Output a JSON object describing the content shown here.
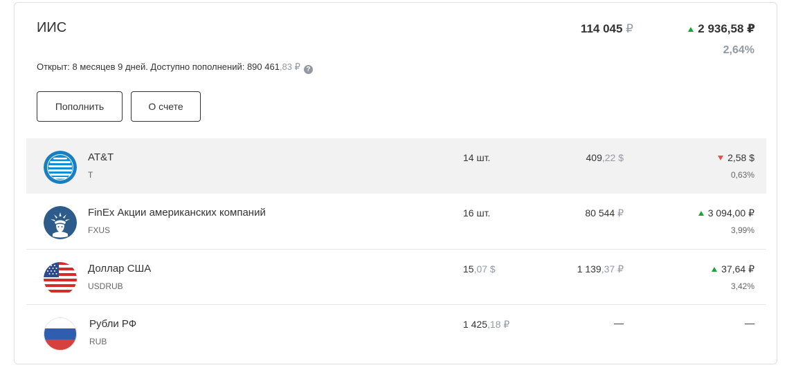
{
  "account": {
    "title": "ИИС",
    "total_int": "114 045",
    "total_currency": "₽",
    "gain": "2 936,58 ₽",
    "gain_pct": "2,64%",
    "info_prefix": "Открыт: 8 месяцев 9 дней. Доступно пополнений: 890 461",
    "info_frac": ",83 ₽",
    "help_glyph": "?"
  },
  "buttons": {
    "topup": "Пополнить",
    "about": "О счете"
  },
  "holdings": [
    {
      "name": "AT&T",
      "ticker": "T",
      "qty": "14 шт.",
      "price_int": "409",
      "price_frac": ",22 $",
      "change": "2,58 $",
      "change_dir": "down",
      "change_pct": "0,63%",
      "logo": "att-logo-icon"
    },
    {
      "name": "FinEx Акции американских компаний",
      "ticker": "FXUS",
      "qty": "16 шт.",
      "price_int": "80 544",
      "price_frac": " ₽",
      "change": "3 094,00 ₽",
      "change_dir": "up",
      "change_pct": "3,99%",
      "logo": "finex-statue-of-liberty-icon"
    },
    {
      "name": "Доллар США",
      "ticker": "USDRUB",
      "qty_int": "15",
      "qty_frac": ",07 $",
      "price_int": "1 139",
      "price_frac": ",37 ₽",
      "change": "37,64 ₽",
      "change_dir": "up",
      "change_pct": "3,42%",
      "logo": "us-flag-icon"
    },
    {
      "name": "Рубли РФ",
      "ticker": "RUB",
      "qty_int": "1 425",
      "qty_frac": ",18 ₽",
      "price": "—",
      "change": "—",
      "logo": "russia-flag-icon"
    }
  ],
  "colors": {
    "up": "#21a038",
    "down": "#e5524e",
    "muted": "#9299a2",
    "selected_row": "#f2f2f2"
  }
}
